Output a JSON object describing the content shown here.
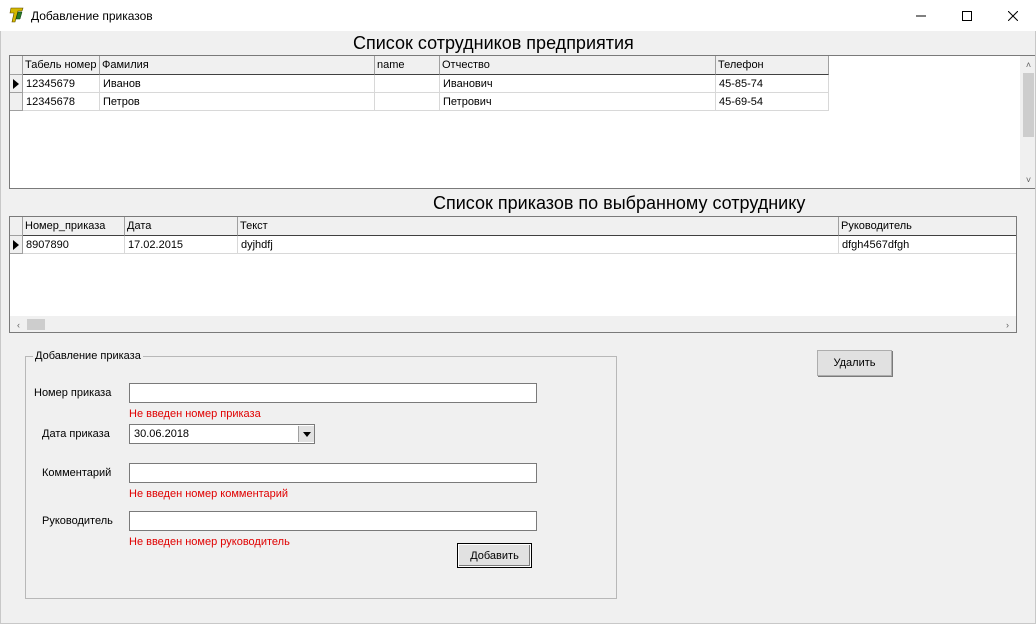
{
  "window": {
    "title": "Добавление приказов",
    "icon": "delphi-app-icon"
  },
  "employees": {
    "heading": "Список сотрудников предприятия",
    "columns": [
      "Табель номер",
      "Фамилия",
      "name",
      "Отчество",
      "Телефон"
    ],
    "rows": [
      [
        "12345679",
        "Иванов",
        "",
        "Иванович",
        "45-85-74"
      ],
      [
        "12345678",
        "Петров",
        "",
        "Петрович",
        "45-69-54"
      ]
    ],
    "selected_row": 0
  },
  "orders": {
    "heading": "Список приказов по выбранному сотруднику",
    "columns": [
      "Номер_приказа",
      "Дата",
      "Текст",
      "Руководитель"
    ],
    "rows": [
      [
        "8907890",
        "17.02.2015",
        "dyjhdfj",
        "dfgh4567dfgh"
      ]
    ],
    "selected_row": 0
  },
  "form": {
    "group_title": "Добавление приказа",
    "order_number_label": "Номер приказа",
    "order_number_value": "",
    "order_number_error": "Не введен номер приказа",
    "date_label": "Дата приказа",
    "date_value": "30.06.2018",
    "comment_label": "Комментарий",
    "comment_value": "",
    "comment_error": "Не введен номер комментарий",
    "manager_label": "Руководитель",
    "manager_value": "",
    "manager_error": "Не введен номер руководитель",
    "add_button": "Добавить"
  },
  "delete_button": "Удалить",
  "colors": {
    "error": "#e00000",
    "background": "#f0f0f0"
  }
}
